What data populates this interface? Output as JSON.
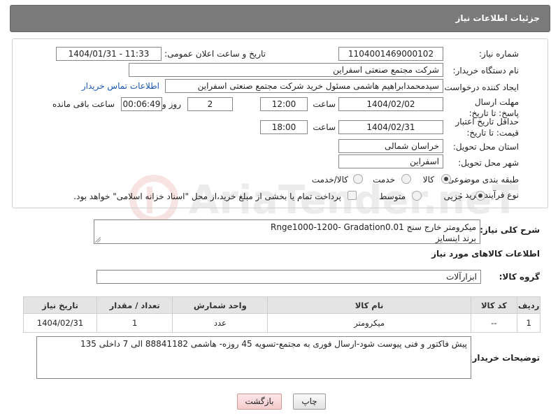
{
  "header": {
    "title": "جزئیات اطلاعات نیاز"
  },
  "form": {
    "need_number_label": "شماره نیاز:",
    "need_number": "1104001469000102",
    "announce_label": "تاریخ و ساعت اعلان عمومی:",
    "announce_value": "1404/01/31 - 11:33",
    "buyer_org_label": "نام دستگاه خریدار:",
    "buyer_org": "شرکت مجتمع صنعتی اسفراین",
    "requester_label": "ایجاد کننده درخواست:",
    "requester": "سیدمحمدابراهیم هاشمی مسئول خرید شرکت مجتمع صنعتی اسفراین",
    "contact_link": "اطلاعات تماس خریدار",
    "deadline_label": "مهلت ارسال پاسخ: تا تاریخ:",
    "deadline_date": "1404/02/02",
    "time_label": "ساعت",
    "deadline_time": "12:00",
    "days_value": "2",
    "days_label": "روز و",
    "remaining_time": "00:06:49",
    "remaining_label": "ساعت باقی مانده",
    "min_price_label": "حداقل تاریخ اعتبار قیمت: تا تاریخ:",
    "min_price_date": "1404/02/31",
    "min_price_time": "18:00",
    "province_label": "استان محل تحویل:",
    "province": "خراسان شمالی",
    "city_label": "شهر محل تحویل:",
    "city": "اسفراین",
    "category_label": "طبقه بندی موضوعی:",
    "category_options": [
      "کالا",
      "خدمت",
      "کالا/خدمت"
    ],
    "process_label": "نوع فرآیند خرید :",
    "process_options": [
      "جزیی",
      "متوسط"
    ],
    "payment_note": "پرداخت تمام یا بخشی از مبلغ خرید،از محل \"اسناد خزانه اسلامی\" خواهد بود."
  },
  "description": {
    "label": "شرح کلی نیاز:",
    "line1": "میکرومتر خارج سنج Rnge1000-1200- Gradation0.01",
    "line2": "برند اینسایز"
  },
  "goods": {
    "section_title": "اطلاعات کالاهای مورد نیاز",
    "group_label": "گروه کالا:",
    "group_value": "ابزارآلات",
    "columns": [
      "ردیف",
      "کد کالا",
      "نام کالا",
      "واحد شمارش",
      "تعداد / مقدار",
      "تاریخ نیاز"
    ],
    "rows": [
      {
        "row": "1",
        "code": "--",
        "name": "میکرومتر",
        "unit": "عدد",
        "qty": "1",
        "date": "1404/02/31"
      }
    ]
  },
  "buyer_notes": {
    "label": "توضیحات خریدار:",
    "text": "پیش فاکتور و فنی پیوست شود-ارسال فوری به مجتمع-تسویه 45 روزه- هاشمی 88841182 الی 7 داخلی 135"
  },
  "buttons": {
    "print": "چاپ",
    "back": "بازگشت"
  },
  "colors": {
    "header_bg": "#7a7a7a",
    "link": "#1a57b4",
    "back_btn": "#f4cccc"
  }
}
